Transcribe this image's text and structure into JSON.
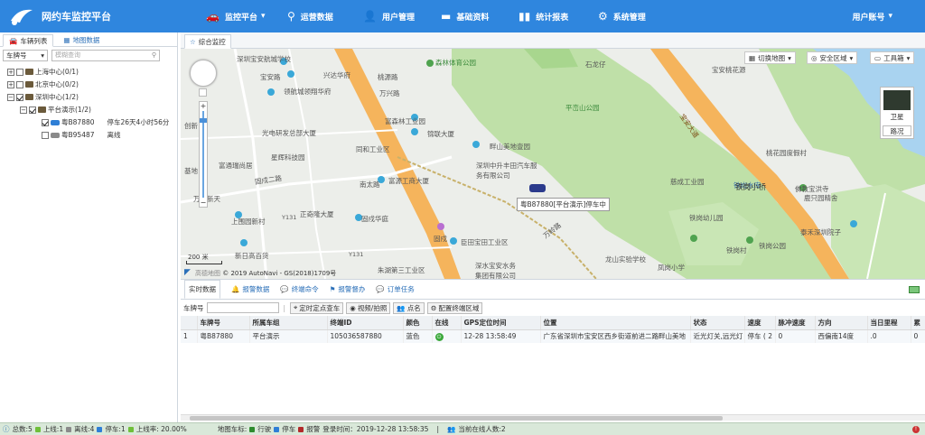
{
  "header": {
    "app_title": "网约车监控平台",
    "nav": [
      {
        "label": "监控平台",
        "icon": "car-icon",
        "dropdown": "▾"
      },
      {
        "label": "运营数据",
        "icon": "location-pin-icon"
      },
      {
        "label": "用户管理",
        "icon": "users-icon"
      },
      {
        "label": "基础资料",
        "icon": "folder-icon"
      },
      {
        "label": "统计报表",
        "icon": "bar-chart-icon"
      },
      {
        "label": "系统管理",
        "icon": "gear-icon"
      }
    ],
    "user_menu": "用户账号",
    "user_caret": "▾"
  },
  "sidebar": {
    "tabs": [
      {
        "label": "车辆列表"
      },
      {
        "label": "地图数据"
      }
    ],
    "search": {
      "field_label": "车牌号",
      "placeholder": "模糊查询"
    },
    "tree": [
      {
        "label": "上海中心(0/1)"
      },
      {
        "label": "北京中心(0/2)"
      },
      {
        "label": "深圳中心(1/2)"
      },
      {
        "label": "平台演示(1/2)"
      },
      {
        "plate": "粤B87880",
        "status": "停车26天4小时56分"
      },
      {
        "plate": "粤B95487",
        "status": "离线"
      }
    ]
  },
  "main": {
    "tab_label": "综合监控",
    "map": {
      "controls": {
        "switch_map": "切换地图",
        "safe_zone": "安全区域",
        "toolbox": "工具箱"
      },
      "layer_satellite": "卫星",
      "layer_roads": "路况",
      "vehicle_label": "粤B87880[平台演示]停车中",
      "scale": "200 米",
      "copyright": "© 2019 AutoNavi - GS(2018)1709号",
      "labels": {
        "l1": "深圳宝安航城学校",
        "l2": "兴达华府",
        "l3": "宝安路",
        "l4": "领航城领翔华府",
        "l5": "桃源路",
        "l6": "万兴路",
        "l7": "森林体育公园",
        "l8": "富森林工业园",
        "l9": "锦联大厦",
        "l10": "光电研发总部大厦",
        "l11": "同和工业区",
        "l12": "畔山美地壹园",
        "l13": "富通瑞尚居",
        "l14": "星辉科技园",
        "l15": "富源工商大厦",
        "l16": "深圳中升丰田汽车服务有限公司",
        "l17": "南太路",
        "l18": "万丰新天",
        "l19": "上围园新村",
        "l20": "正奇隆大厦",
        "l21": "固戍华庭",
        "l22": "固戍",
        "l23": "臣田宝田工业区",
        "l24": "新日高百货",
        "l25": "朱湖第三工业区",
        "l26": "深水宝安水务集团有限公司",
        "l27": "龙山实验学校",
        "l28": "凤岗小学",
        "l29": "铁岗水库",
        "l30": "铁岗小桥",
        "l31": "铁岗幼儿园",
        "l32": "铁岗公园",
        "l33": "慈成工业园",
        "l34": "泰禾深圳院子",
        "l35": "佛教宝洪寺",
        "l36": "桃花园度假村",
        "l37": "鹿只园精舍",
        "l38": "宝安桃花源",
        "l39": "平峦山公园",
        "l40": "铁岗村",
        "l41": "宝安大道",
        "l42": "创新",
        "l43": "基地",
        "l44": "固戍二路",
        "l45": "Y131",
        "l46": "Y131",
        "l47": "石龙仔",
        "l48": "万岭路"
      }
    },
    "bottom": {
      "tabs": [
        "实时数据",
        "报警数据",
        "终端命令",
        "报警督办",
        "订单任务"
      ],
      "toolbar": {
        "plate_label": "车牌号",
        "btn_locate": "定时定点查车",
        "btn_video": "视频/拍照",
        "btn_rollcall": "点名",
        "btn_config": "配置终端区域"
      },
      "columns": [
        "车牌号",
        "所属车组",
        "终端ID",
        "颜色",
        "在线",
        "GPS定位时间",
        "位置",
        "状态",
        "速度",
        "脉冲速度",
        "方向",
        "当日里程",
        "累"
      ],
      "rows": [
        {
          "index": "1",
          "plate": "粤B87880",
          "group": "平台演示",
          "terminal": "105036587880",
          "color": "蓝色",
          "online": "在线",
          "gps_time": "12-28 13:58:49",
          "location": "广东省深圳市宝安区西乡街道前进二路畔山美地",
          "state": "近光灯关,远光灯",
          "speed": "停车 ( 2",
          "pulse_speed": "0",
          "direction": "西偏南14度",
          "mileage": ".0",
          "total": "0"
        }
      ]
    }
  },
  "statusbar": {
    "total": "总数:5",
    "online": "上线:1",
    "offline": "离线:4",
    "parked": "停车:1",
    "online_rate": "上线率: 20.00%",
    "legend_label": "地图车标:",
    "legend_moving": "行驶",
    "legend_parked": "停车",
    "legend_alarm": "报警",
    "login_time": "登录时间：2019-12-28 13:58:35",
    "users_online": "当前在线人数:2"
  },
  "colors": {
    "header": "#2f86de",
    "status_green": "#6fbf3a",
    "status_blue": "#2f7fd6",
    "alarm_red": "#b22a2a"
  }
}
